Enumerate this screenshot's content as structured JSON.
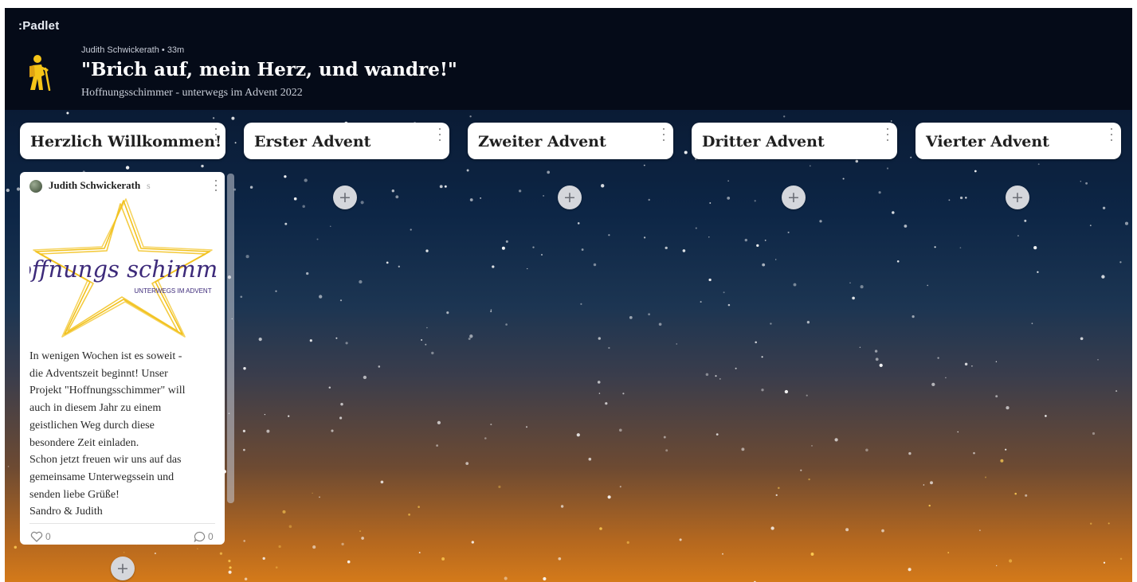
{
  "app": {
    "brand": ":Padlet"
  },
  "header": {
    "author": "Judith Schwickerath",
    "time": "33m",
    "title": "\"Brich auf, mein Herz, und wandre!\"",
    "subtitle": "Hoffnungsschimmer - unterwegs im Advent 2022",
    "icon": "hiker-icon"
  },
  "columns": [
    {
      "title": "Herzlich Willkommen!"
    },
    {
      "title": "Erster Advent"
    },
    {
      "title": "Zweiter Advent"
    },
    {
      "title": "Dritter Advent"
    },
    {
      "title": "Vierter Advent"
    }
  ],
  "add_label": "+",
  "post": {
    "author": "Judith Schwickerath",
    "time_short": "s",
    "image_text": {
      "main": "hoffnungs schimmer",
      "tagline": "UNTERWEGS IM ADVENT"
    },
    "body_lines": [
      "In wenigen Wochen ist es soweit -",
      "die Adventszeit beginnt! Unser",
      "Projekt \"Hoffnungsschimmer\" will",
      "auch in diesem Jahr zu einem",
      "geistlichen Weg durch diese",
      "besondere Zeit einladen.",
      "Schon jetzt freuen wir uns auf das",
      "gemeinsame Unterwegssein und",
      "senden liebe Grüße!",
      "Sandro & Judith"
    ],
    "likes": "0",
    "comments": "0"
  },
  "colors": {
    "topbar": "#050b18",
    "hiker": "#f5c518",
    "star": "#f2c21e",
    "logo_text": "#3d2a7a"
  }
}
